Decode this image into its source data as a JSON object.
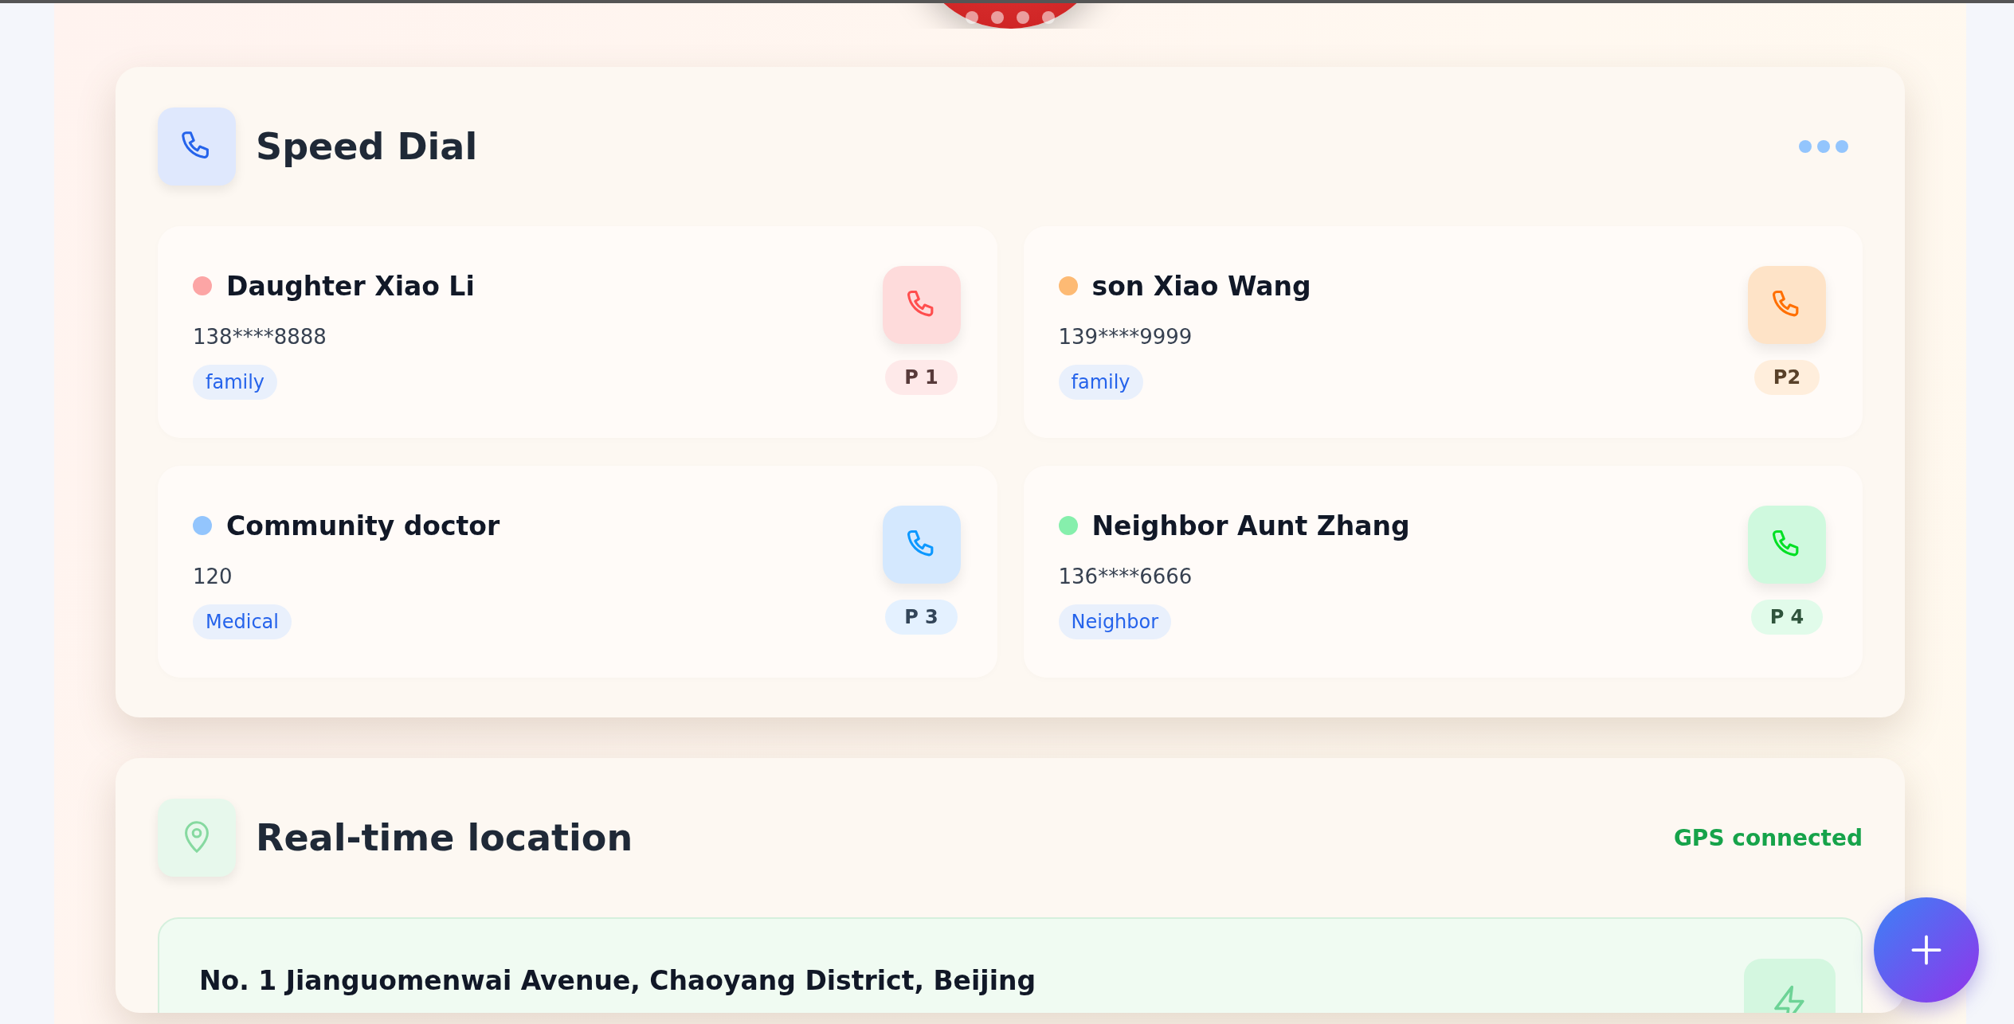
{
  "speed_dial": {
    "title": "Speed Dial",
    "contacts": [
      {
        "name": "Daughter Xiao Li",
        "phone": "138****8888",
        "tag": "family",
        "priority": "P 1",
        "color": "#fca5a5"
      },
      {
        "name": "son Xiao Wang",
        "phone": "139****9999",
        "tag": "family",
        "priority": "P2",
        "color": "#fdba74"
      },
      {
        "name": "Community doctor",
        "phone": "120",
        "tag": "Medical",
        "priority": "P 3",
        "color": "#93c5fd"
      },
      {
        "name": "Neighbor Aunt Zhang",
        "phone": "136****6666",
        "tag": "Neighbor",
        "priority": "P 4",
        "color": "#86efac"
      }
    ]
  },
  "location": {
    "title": "Real-time location",
    "status": "GPS connected",
    "address": "No. 1 Jianguomenwai Avenue, Chaoyang District, Beijing"
  }
}
